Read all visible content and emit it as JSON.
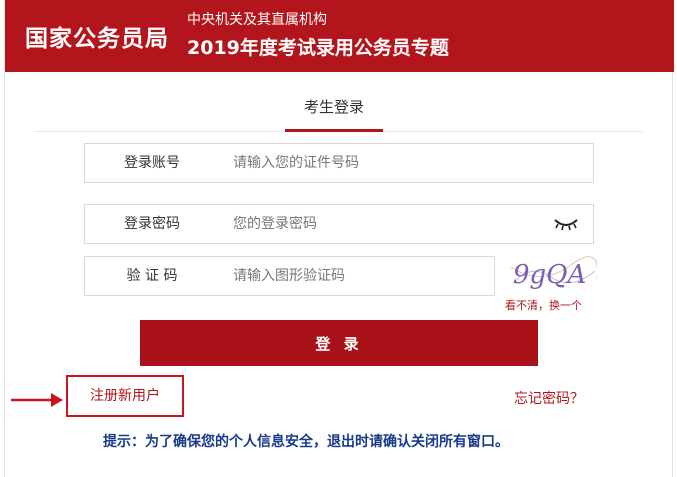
{
  "header": {
    "brand": "国家公务员局",
    "subtitle_line1": "中央机关及其直属机构",
    "subtitle_line2": "2019年度考试录用公务员专题"
  },
  "tabs": {
    "active_label": "考生登录"
  },
  "form": {
    "account": {
      "label": "登录账号",
      "placeholder": "请输入您的证件号码"
    },
    "password": {
      "label": "登录密码",
      "placeholder": "您的登录密码"
    },
    "captcha": {
      "label": "验 证 码",
      "placeholder": "请输入图形验证码",
      "image_text": "9gQA",
      "refresh_text": "看不清，换一个"
    },
    "login_label": "登 录"
  },
  "links": {
    "register": "注册新用户",
    "forgot": "忘记密码？"
  },
  "tip": "提示：为了确保您的个人信息安全，退出时请确认关闭所有窗口。",
  "colors": {
    "brand_red": "#b2161c",
    "button_red": "#a91218",
    "tip_blue": "#1a3a8c"
  },
  "icons": {
    "password_toggle": "eye-closed-icon",
    "register_pointer": "arrow-right-icon"
  }
}
